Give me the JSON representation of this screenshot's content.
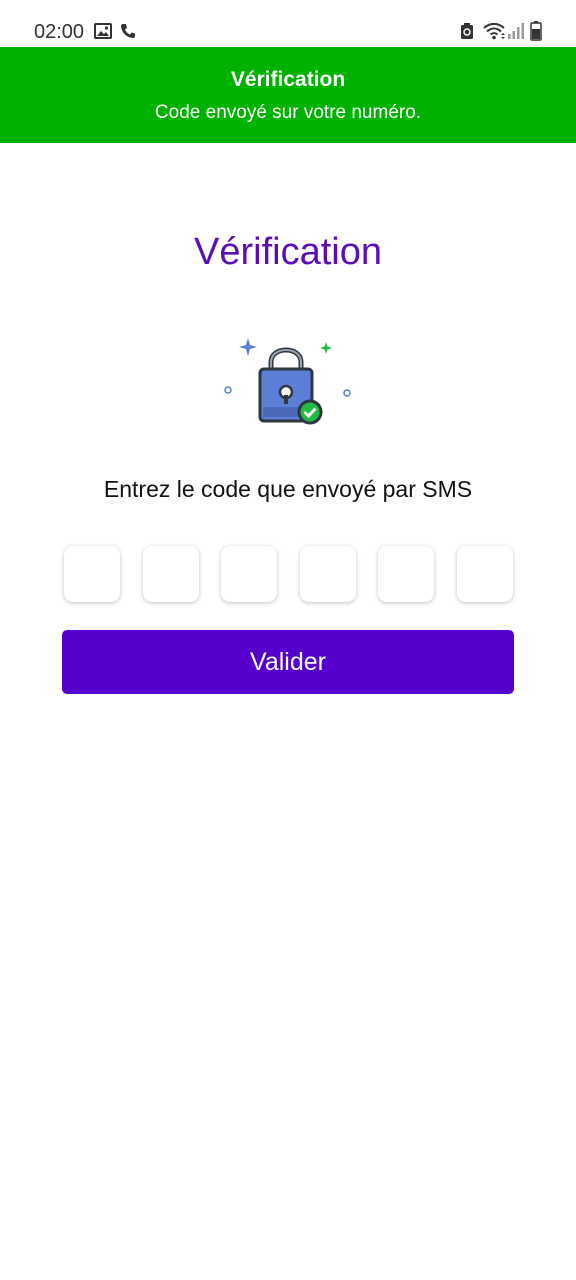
{
  "status_bar": {
    "time": "02:00",
    "icons": [
      "gallery-icon",
      "phone-icon",
      "lock-icon",
      "wifi-icon",
      "signal-icon",
      "battery-icon"
    ]
  },
  "header": {
    "title": "Vérification",
    "subtitle": "Code envoyé sur votre numéro.",
    "background_color": "#00b200"
  },
  "main": {
    "title": "Vérification",
    "title_color": "#5a0eb5",
    "illustration": "padlock-check-icon",
    "instruction": "Entrez le code que envoyé par SMS",
    "code_inputs": [
      {
        "value": ""
      },
      {
        "value": ""
      },
      {
        "value": ""
      },
      {
        "value": ""
      },
      {
        "value": ""
      },
      {
        "value": ""
      }
    ],
    "validate_label": "Valider",
    "button_color": "#5500cc"
  }
}
